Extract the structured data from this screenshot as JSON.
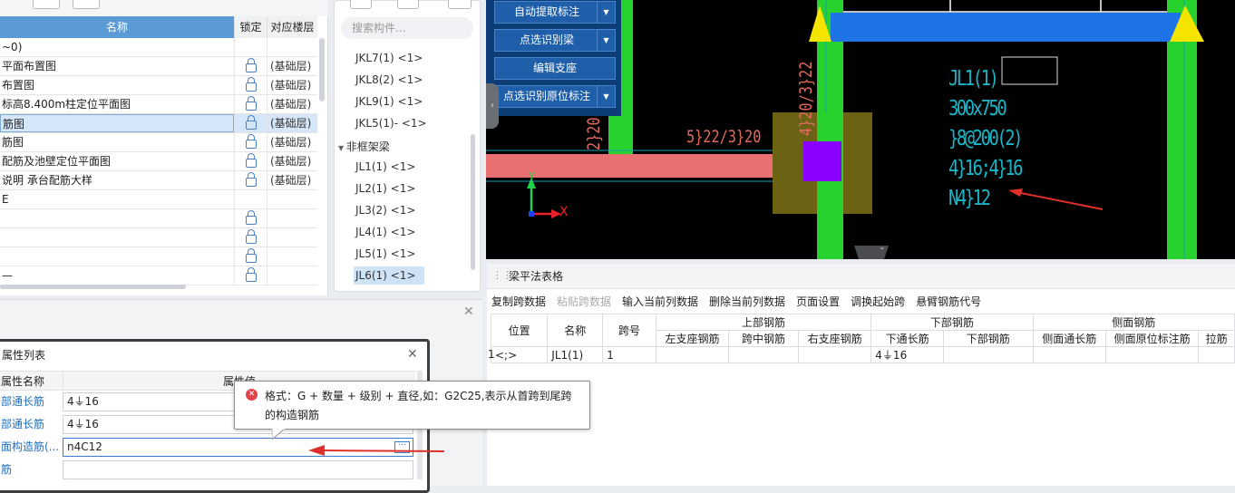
{
  "left_table": {
    "headers": {
      "name": "名称",
      "lock": "锁定",
      "floor": "对应楼层"
    },
    "rows": [
      {
        "name": "~0)",
        "lock": false,
        "floor": ""
      },
      {
        "name": "平面布置图",
        "lock": true,
        "floor": "(基础层)"
      },
      {
        "name": "布置图",
        "lock": true,
        "floor": "(基础层)"
      },
      {
        "name": "标高8.400m柱定位平面图",
        "lock": true,
        "floor": "(基础层)"
      },
      {
        "name": "筋图",
        "lock": true,
        "floor": "(基础层)"
      },
      {
        "name": "筋图",
        "lock": true,
        "floor": "(基础层)"
      },
      {
        "name": "配筋及池壁定位平面图",
        "lock": true,
        "floor": "(基础层)"
      },
      {
        "name": "说明 承台配筋大样",
        "lock": true,
        "floor": "(基础层)"
      },
      {
        "name": "E",
        "lock": false,
        "floor": ""
      },
      {
        "name": "",
        "lock": true,
        "floor": ""
      },
      {
        "name": "",
        "lock": true,
        "floor": ""
      },
      {
        "name": "",
        "lock": true,
        "floor": ""
      },
      {
        "name": "—",
        "lock": true,
        "floor": ""
      }
    ]
  },
  "component_panel": {
    "search_placeholder": "搜索构件...",
    "items_a": [
      "JKL7(1) <1>",
      "JKL8(2) <1>",
      "JKL9(1) <1>",
      "JKL5(1)- <1>"
    ],
    "group_label": "非框架梁",
    "items_b": [
      "JL1(1) <1>",
      "JL2(1) <1>",
      "JL3(2) <1>",
      "JL4(1) <1>",
      "JL5(1) <1>",
      "JL6(1) <1>"
    ]
  },
  "cad_buttons": [
    {
      "label": "自动提取标注",
      "dropdown": true
    },
    {
      "label": "点选识别梁",
      "dropdown": true
    },
    {
      "label": "编辑支座",
      "dropdown": false
    },
    {
      "label": "点选识别原位标注",
      "dropdown": true
    }
  ],
  "cad_text": {
    "beam_label": "JL1(1)",
    "section": "300x750",
    "stirrup": "}8@200(2)",
    "rebar": "4}16;4}16",
    "side": "N4}12",
    "left_note": "5}22/3}20",
    "vert_note": "4}20/3}22",
    "vert_note2": "2}20",
    "axis_x": "X",
    "axis_y": "Y"
  },
  "beam_table": {
    "title": "梁平法表格",
    "toolbar": [
      "复制跨数据",
      "粘贴跨数据",
      "输入当前列数据",
      "删除当前列数据",
      "页面设置",
      "调换起始跨",
      "悬臂钢筋代号"
    ],
    "toolbar_disabled": [
      false,
      true,
      false,
      false,
      false,
      false,
      false
    ],
    "col_position": "位置",
    "col_name": "名称",
    "col_span": "跨号",
    "grp_top": "上部钢筋",
    "grp_bottom": "下部钢筋",
    "grp_side": "侧面钢筋",
    "sub_left": "左支座钢筋",
    "sub_mid": "跨中钢筋",
    "sub_right": "右支座钢筋",
    "sub_bot_cont": "下通长筋",
    "sub_bot": "下部钢筋",
    "sub_side_cont": "侧面通长筋",
    "sub_side_orig": "侧面原位标注筋",
    "sub_tie": "拉筋",
    "row": {
      "num": "1",
      "position": "<;>",
      "name": "JL1(1)",
      "span": "1",
      "bot_cont": "4⏚16"
    }
  },
  "property_window": {
    "title": "属性列表",
    "col_name": "属性名称",
    "col_value": "属性值",
    "rows": [
      {
        "name": "部通长筋",
        "value": "4⏚16"
      },
      {
        "name": "部通长筋",
        "value": "4⏚16"
      },
      {
        "name": "面构造筋(...",
        "value": "n4C12"
      },
      {
        "name": "筋",
        "value": ""
      }
    ]
  },
  "tooltip": {
    "line1": "格式：G + 数量 + 级别 + 直径,如：G2C25,表示从首跨到尾跨",
    "line2": "的构造钢筋"
  },
  "colors": {
    "accent": "#5b9bd5",
    "cad_bg": "#000000",
    "beam_blue": "#1e73e6",
    "column_green": "#27d22e",
    "arrow_red": "#e0302a"
  }
}
